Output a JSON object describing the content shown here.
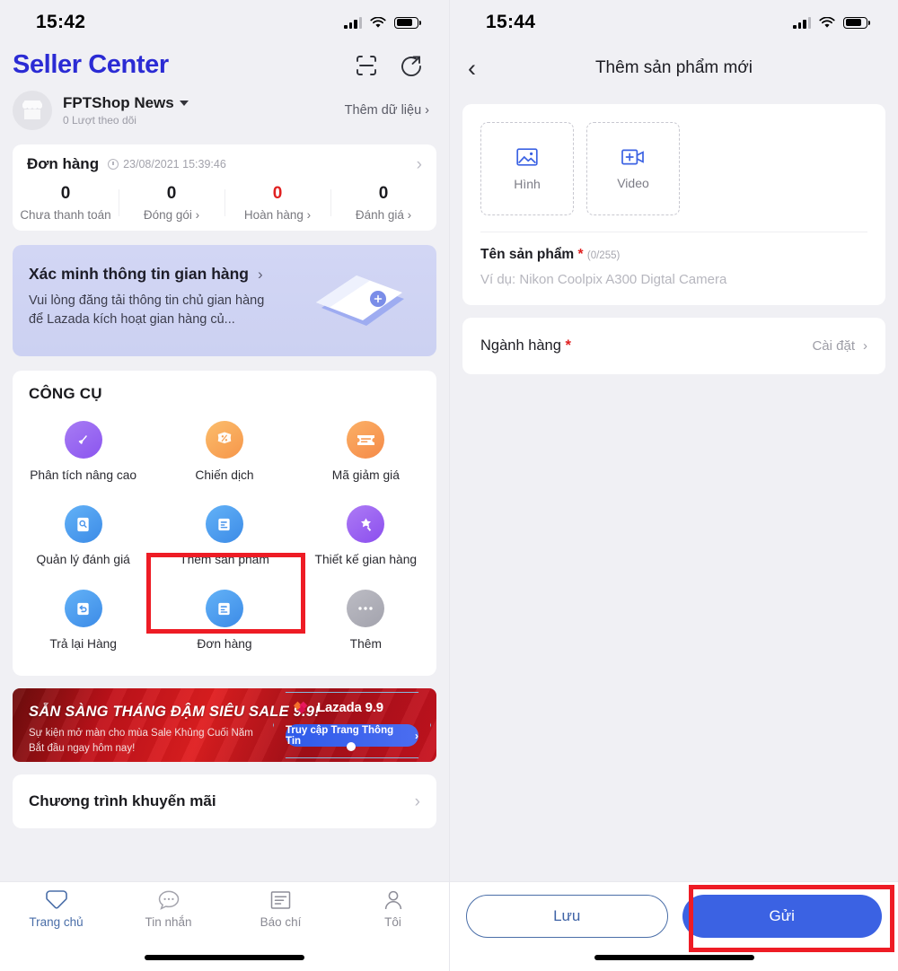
{
  "left": {
    "status": {
      "time": "15:42"
    },
    "header": {
      "brand": "Seller Center",
      "scan_icon": "scan-icon",
      "share_icon": "share-icon"
    },
    "shop": {
      "name": "FPTShop News",
      "followers": "0 Lượt theo dõi",
      "add_data_link": "Thêm dữ liệu ›"
    },
    "orders": {
      "title": "Đơn hàng",
      "timestamp": "23/08/2021 15:39:46",
      "stats": [
        {
          "value": "0",
          "label": "Chưa thanh toán",
          "red": false
        },
        {
          "value": "0",
          "label": "Đóng gói ›",
          "red": false
        },
        {
          "value": "0",
          "label": "Hoàn hàng ›",
          "red": true
        },
        {
          "value": "0",
          "label": "Đánh giá ›",
          "red": false
        }
      ]
    },
    "verify": {
      "title": "Xác minh thông tin gian hàng",
      "chevron": "›",
      "desc": "Vui lòng đăng tải thông tin chủ gian hàng để Lazada kích hoạt gian hàng củ..."
    },
    "tools": {
      "heading": "CÔNG CỤ",
      "items": [
        {
          "label": "Phân tích nâng cao",
          "icon": "analytics-icon",
          "color1": "#9b6bf0",
          "color2": "#8a5bee"
        },
        {
          "label": "Chiến dịch",
          "icon": "percent-badge-icon",
          "color1": "#f8b25c",
          "color2": "#f59a4a"
        },
        {
          "label": "Mã giảm giá",
          "icon": "voucher-icon",
          "color1": "#f9a95a",
          "color2": "#f58b48"
        },
        {
          "label": "Quản lý đánh giá",
          "icon": "review-search-icon",
          "color1": "#56a9f5",
          "color2": "#3d8de8"
        },
        {
          "label": "Thêm sản phẩm",
          "icon": "add-product-icon",
          "color1": "#56a9f5",
          "color2": "#3d8de8"
        },
        {
          "label": "Thiết kế gian hàng",
          "icon": "store-design-icon",
          "color1": "#a06bf0",
          "color2": "#8a4fe8"
        },
        {
          "label": "Trả lại Hàng",
          "icon": "return-icon",
          "color1": "#56a9f5",
          "color2": "#3d8de8"
        },
        {
          "label": "Đơn hàng",
          "icon": "order-doc-icon",
          "color1": "#56a9f5",
          "color2": "#3d8de8"
        },
        {
          "label": "Thêm",
          "icon": "more-dots-icon",
          "color1": "#b4b4bd",
          "color2": "#a2a2ac"
        }
      ],
      "highlight_label": "Thêm sản phẩm"
    },
    "banner": {
      "title": "SẴN SÀNG THÁNG ĐẬM SIÊU SALE 9.9!",
      "sub_line1": "Sự kiện mở màn cho mùa Sale Khủng Cuối Năm",
      "sub_line2": "Bắt đầu ngay hôm nay!",
      "logo_text": "Lazada 9.9",
      "cta": "Truy cập Trang Thông Tin"
    },
    "promo": {
      "title": "Chương trình khuyến mãi",
      "chevron": "›"
    },
    "tabbar": [
      {
        "label": "Trang chủ",
        "icon": "home-heart-icon",
        "active": true
      },
      {
        "label": "Tin nhắn",
        "icon": "chat-icon",
        "active": false
      },
      {
        "label": "Báo chí",
        "icon": "news-icon",
        "active": false
      },
      {
        "label": "Tôi",
        "icon": "person-icon",
        "active": false
      }
    ]
  },
  "right": {
    "status": {
      "time": "15:44"
    },
    "nav": {
      "back_icon": "chevron-left-icon",
      "title": "Thêm sản phẩm mới"
    },
    "media": [
      {
        "label": "Hình",
        "icon": "image-icon"
      },
      {
        "label": "Video",
        "icon": "video-plus-icon"
      }
    ],
    "product_name": {
      "label": "Tên sản phẩm",
      "required": "*",
      "counter": "(0/255)",
      "placeholder": "Ví dụ: Nikon Coolpix A300 Digtal Camera",
      "value": ""
    },
    "category": {
      "label": "Ngành hàng",
      "required": "*",
      "action": "Cài đặt",
      "chevron": "›"
    },
    "actions": {
      "save": "Lưu",
      "send": "Gửi"
    }
  },
  "colors": {
    "brand_blue": "#2b2bd4",
    "primary_blue": "#3b62e3",
    "highlight_red": "#ee1c25",
    "danger_red": "#e02020"
  }
}
